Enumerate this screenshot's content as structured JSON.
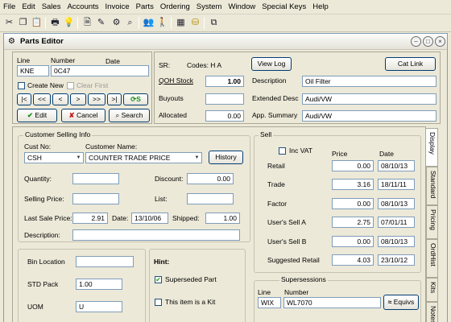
{
  "menu": [
    "File",
    "Edit",
    "Sales",
    "Accounts",
    "Invoice",
    "Parts",
    "Ordering",
    "System",
    "Window",
    "Special Keys",
    "Help"
  ],
  "window": {
    "title": "Parts Editor"
  },
  "part": {
    "line_label": "Line",
    "line": "KNE",
    "number_label": "Number",
    "number": "0C47",
    "date_label": "Date",
    "date": "",
    "create_new": "Create New",
    "clear_first": "Clear First",
    "nav": [
      "|<",
      "<<",
      "<",
      ">",
      ">>",
      ">|"
    ],
    "edit": "Edit",
    "cancel": "Cancel",
    "search": "Search"
  },
  "info": {
    "sr_label": "SR:",
    "codes": "Codes: H A",
    "view_log": "View Log",
    "cat_link": "Cat Link",
    "qoh_label": "QOH Stock",
    "qoh": "1.00",
    "buyouts_label": "Buyouts",
    "buyouts": "",
    "allocated_label": "Allocated",
    "allocated": "0.00",
    "desc_label": "Description",
    "desc": "Oil Filter",
    "ext_label": "Extended Desc",
    "ext": "Audi/VW",
    "app_label": "App. Summary",
    "app": "Audi/VW"
  },
  "customer": {
    "title": "Customer Selling Info",
    "cust_no_label": "Cust No:",
    "cust_no": "CSH",
    "cust_name_label": "Customer Name:",
    "cust_name": "COUNTER TRADE PRICE",
    "history": "History",
    "quantity_label": "Quantity:",
    "quantity": "",
    "discount_label": "Discount:",
    "discount": "0.00",
    "selling_label": "Selling Price:",
    "selling": "",
    "list_label": "List:",
    "list": "",
    "last_sale_label": "Last Sale Price:",
    "last_sale": "2.91",
    "date_label": "Date:",
    "date": "13/10/06",
    "shipped_label": "Shipped:",
    "shipped": "1.00",
    "description_label": "Description:",
    "description": ""
  },
  "bin": {
    "bin_label": "Bin Location",
    "bin": "",
    "std_label": "STD Pack",
    "std": "1.00",
    "uom_label": "UOM",
    "uom": "U"
  },
  "hint": {
    "title": "Hint:",
    "superseded": "Superseded Part",
    "kit": "This item is a Kit"
  },
  "sell": {
    "title": "Sell",
    "inc_vat": "Inc VAT",
    "price_header": "Price",
    "date_header": "Date",
    "rows": [
      {
        "label": "Retail",
        "price": "0.00",
        "date": "08/10/13"
      },
      {
        "label": "Trade",
        "price": "3.16",
        "date": "18/11/11"
      },
      {
        "label": "Factor",
        "price": "0.00",
        "date": "08/10/13"
      },
      {
        "label": "User's Sell A",
        "price": "2.75",
        "date": "07/01/11"
      },
      {
        "label": "User's Sell B",
        "price": "0.00",
        "date": "08/10/13"
      },
      {
        "label": "Suggested Retail",
        "price": "4.03",
        "date": "23/10/12"
      }
    ]
  },
  "supersessions": {
    "title": "Supersessions",
    "line_label": "Line",
    "line": "WIX",
    "number_label": "Number",
    "number": "WL7070",
    "equivs": "Equivs"
  },
  "tabs": [
    "Display",
    "Standard",
    "Pricing",
    "OrdHist",
    "Kits",
    "Notes"
  ]
}
